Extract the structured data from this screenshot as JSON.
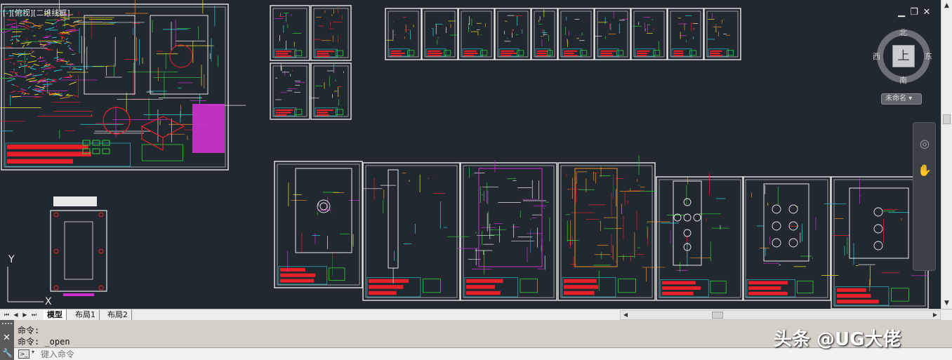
{
  "viewport": {
    "label": "[-][俯视][二维线框]"
  },
  "viewcube": {
    "north": "北",
    "south": "南",
    "east": "东",
    "west": "西",
    "face": "上",
    "ucs": "未命名"
  },
  "window_controls": {
    "minimize": "▁",
    "restore": "❐",
    "close": "✕"
  },
  "tabs": [
    {
      "label": "模型",
      "active": true
    },
    {
      "label": "布局1",
      "active": false
    },
    {
      "label": "布局2",
      "active": false
    }
  ],
  "command": {
    "history": [
      "命令:",
      "命令: _open"
    ],
    "placeholder": "键入命令"
  },
  "watermark": "头条 @UG大佬",
  "colors": {
    "canvas_bg": "#212830",
    "cad_red": "#e8202a",
    "cad_green": "#2fd03a",
    "cad_yellow": "#f0e020",
    "cad_cyan": "#28d0e0",
    "cad_magenta": "#d030d0",
    "cad_orange": "#f09020",
    "cad_white": "#e8e8e8"
  }
}
